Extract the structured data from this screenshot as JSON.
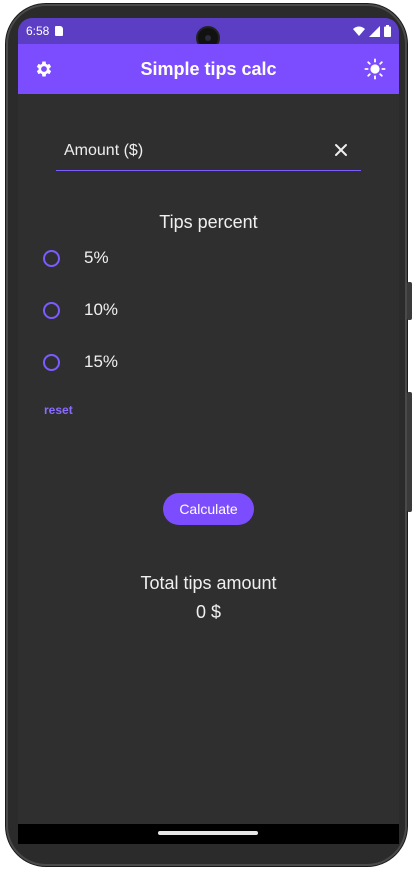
{
  "status_bar": {
    "time": "6:58",
    "icons": [
      "sd-card-icon",
      "wifi-icon",
      "signal-icon",
      "battery-icon"
    ]
  },
  "app_bar": {
    "title": "Simple tips calc",
    "left_icon": "gear-icon",
    "right_icon": "sun-icon"
  },
  "amount_field": {
    "label": "Amount ($)",
    "value": "",
    "clear_icon": "close-icon"
  },
  "tips": {
    "title": "Tips percent",
    "options": [
      {
        "label": "5%",
        "selected": false
      },
      {
        "label": "10%",
        "selected": false
      },
      {
        "label": "15%",
        "selected": false
      }
    ],
    "reset_label": "reset"
  },
  "calculate_button": {
    "label": "Calculate"
  },
  "total": {
    "title": "Total tips amount",
    "value": "0 $"
  },
  "colors": {
    "status_bar": "#5b3ec4",
    "app_bar": "#7c4dff",
    "background": "#2f2f2f",
    "accent": "#7c5cff"
  }
}
